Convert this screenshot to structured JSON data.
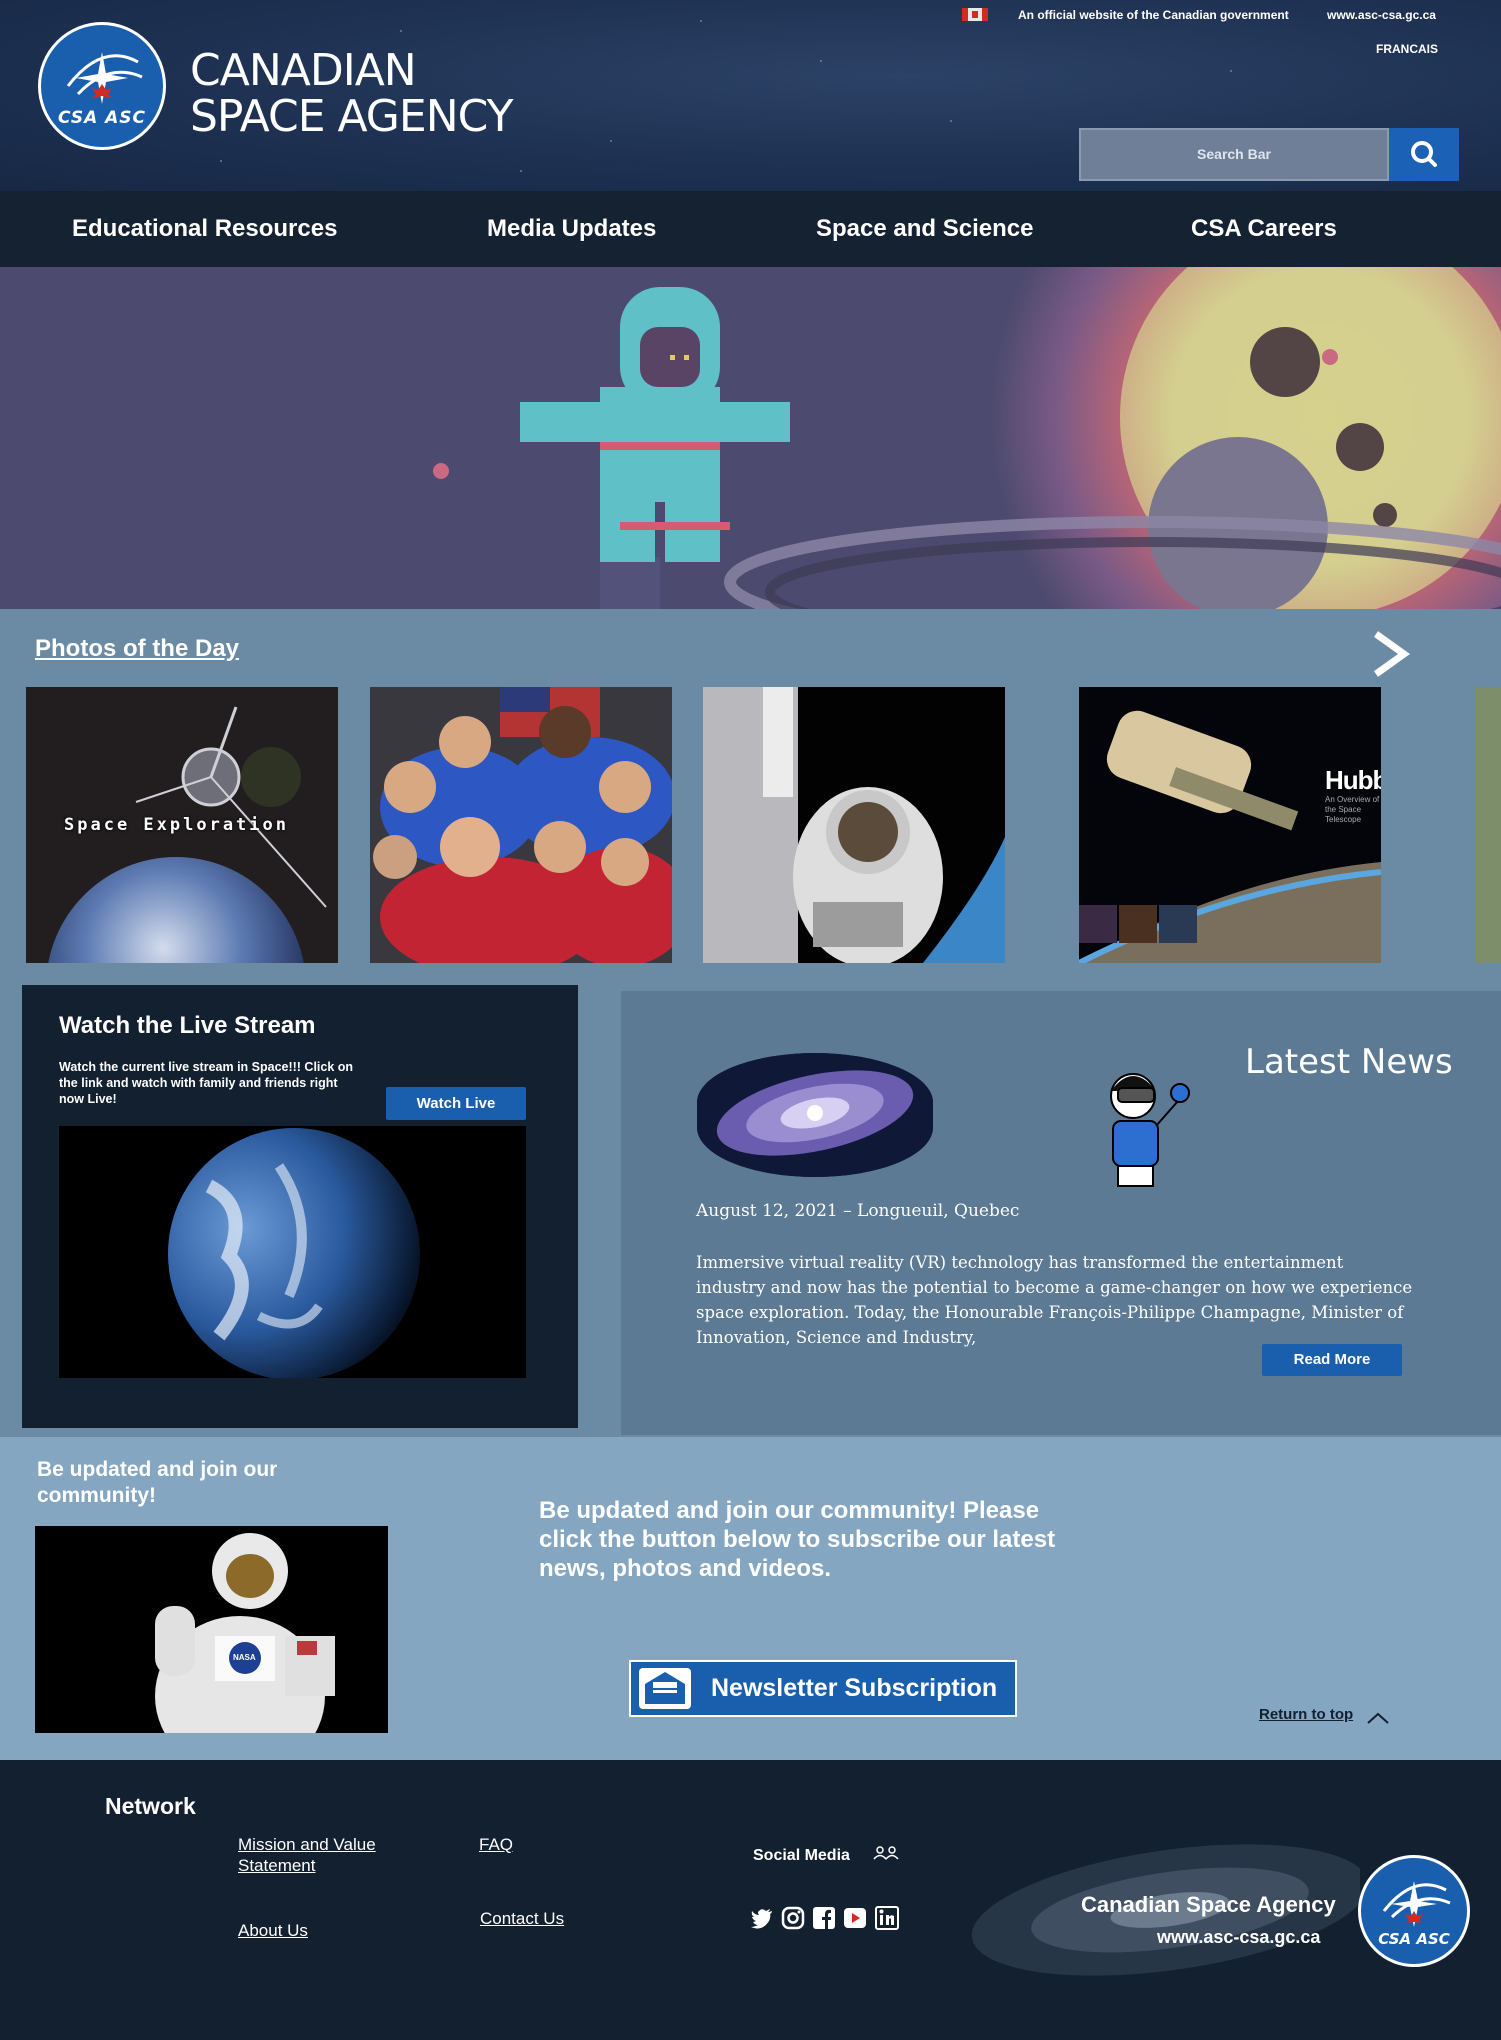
{
  "header": {
    "logo_text": "CSA ASC",
    "brand_line1": "CANADIAN",
    "brand_line2": "SPACE AGENCY",
    "gov_text": "An official website of the Canadian government",
    "gov_url": "www.asc-csa.gc.ca",
    "language_link": "FRANCAIS",
    "search_placeholder": "Search Bar"
  },
  "nav": {
    "items": [
      "Educational Resources",
      "Media Updates",
      "Space and Science",
      "CSA Careers"
    ]
  },
  "photos": {
    "title": "Photos of the Day",
    "photo1_label": "Space Exploration",
    "photo4_title": "Hubble",
    "photo4_subtitle": "An Overview of the Space Telescope"
  },
  "live": {
    "title": "Watch the Live Stream",
    "description": "Watch the current live stream in Space!!! Click on the link and watch with family and friends right now Live!",
    "button": "Watch Live"
  },
  "news": {
    "title": "Latest News",
    "date": "August 12, 2021 – Longueuil, Quebec",
    "body": "Immersive virtual reality (VR) technology has transformed the entertainment industry and now has the potential to become a game-changer on how we experience space exploration. Today, the Honourable François-Philippe Champagne, Minister of Innovation, Science and Industry,",
    "button": "Read More"
  },
  "community": {
    "title": "Be updated and join our community!",
    "text": "Be updated and join our community! Please click the button below to subscribe our latest news, photos and videos.",
    "newsletter_button": "Newsletter Subscription",
    "nasa_badge": "NASA",
    "return_link": "Return to top"
  },
  "footer": {
    "network_title": "Network",
    "links": {
      "mission_line1": "Mission and Value",
      "mission_line2": "Statement",
      "faq": "FAQ",
      "about": "About Us",
      "contact": "Contact Us"
    },
    "social_label": "Social Media",
    "social_icons": [
      "twitter-icon",
      "instagram-icon",
      "facebook-icon",
      "youtube-icon",
      "linkedin-icon"
    ],
    "org_name": "Canadian Space Agency",
    "org_url": "www.asc-csa.gc.ca",
    "logo_text": "CSA ASC"
  },
  "colors": {
    "header_bg": "#1e3152",
    "nav_bg": "#152232",
    "panel_bg": "#6b8aa4",
    "news_bg": "#5d7a95",
    "community_bg": "#84a6c1",
    "footer_bg": "#132030",
    "accent_blue": "#1a5fae"
  }
}
